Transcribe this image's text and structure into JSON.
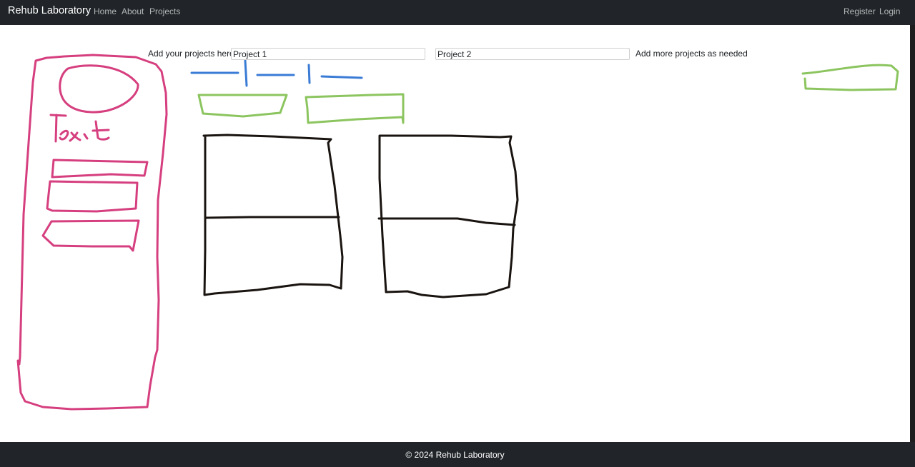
{
  "navbar": {
    "brand": "Rehub Laboratory",
    "links": [
      "Home",
      "About",
      "Projects"
    ],
    "right_links": [
      "Register",
      "Login"
    ]
  },
  "main": {
    "add_label": "Add your projects here",
    "project_inputs": [
      "Project 1",
      "Project 2"
    ],
    "more_label": "Add more projects as needed",
    "sketch_texts": [
      "Text"
    ]
  },
  "footer": {
    "copyright": "© 2024 Rehub Laboratory"
  },
  "colors": {
    "navbar_bg": "#212529",
    "sketch_pink": "#d63f7f",
    "sketch_blue": "#3a7bd5",
    "sketch_green": "#8cc55f",
    "sketch_black": "#1a1410"
  }
}
